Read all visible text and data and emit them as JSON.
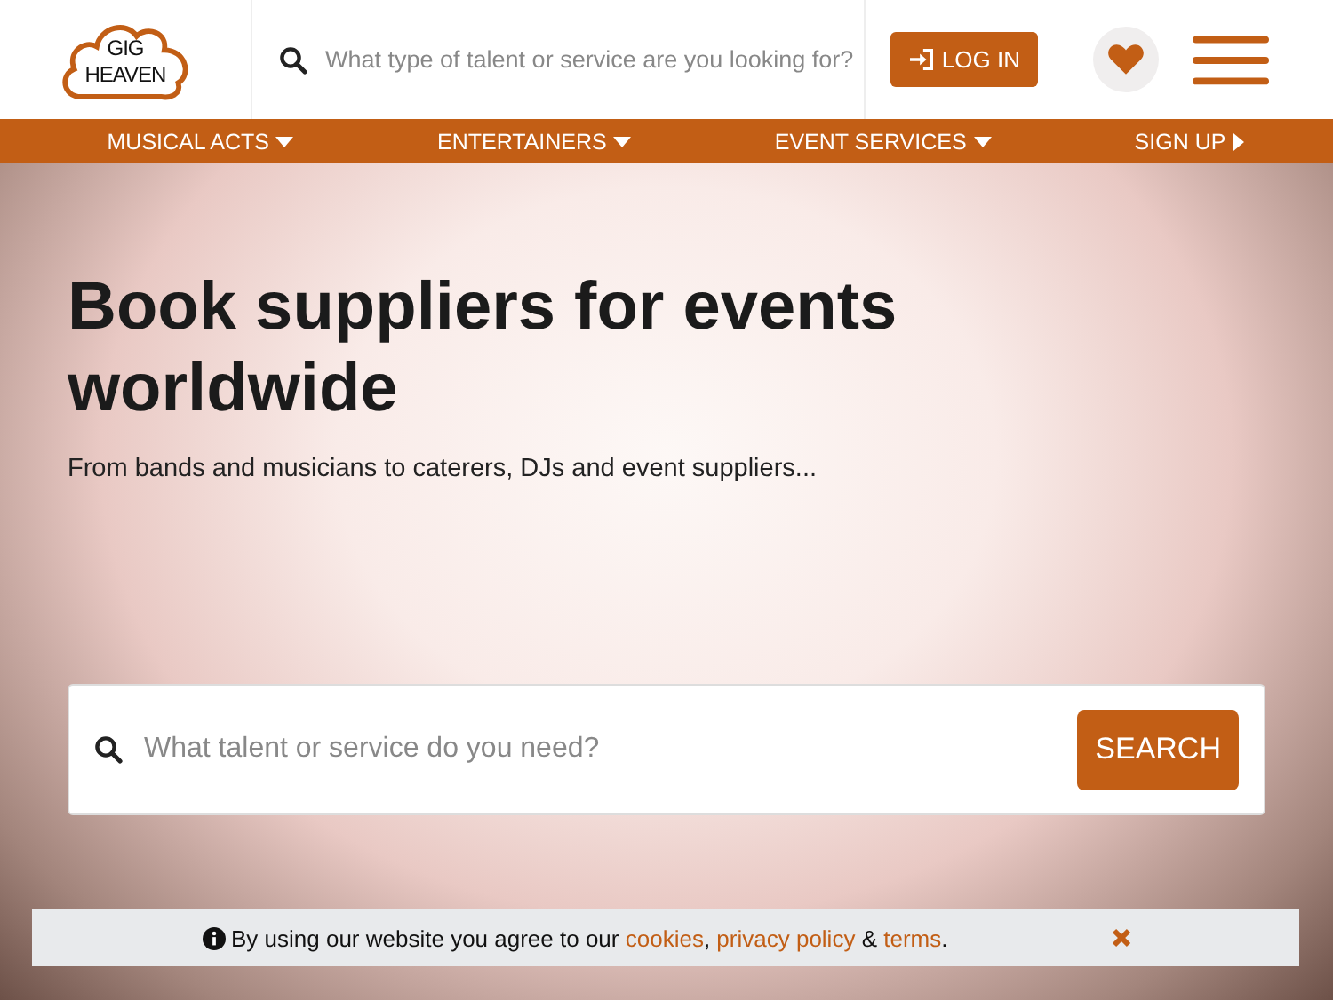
{
  "logo": {
    "line_1": "GIG",
    "line_2": "HEAVEN"
  },
  "header_search": {
    "placeholder": "What type of talent or service are you looking for?"
  },
  "login_button": "LOG IN",
  "nav": [
    {
      "label": "MUSICAL ACTS",
      "kind": "dropdown"
    },
    {
      "label": "ENTERTAINERS",
      "kind": "dropdown"
    },
    {
      "label": "EVENT SERVICES",
      "kind": "dropdown"
    },
    {
      "label": "SIGN UP",
      "kind": "link"
    }
  ],
  "hero": {
    "title": "Book suppliers for events worldwide",
    "subtitle": "From bands and musicians to caterers, DJs and event suppliers...",
    "search": {
      "placeholder": "What talent or service do you need?"
    },
    "search_button": "SEARCH"
  },
  "cookie_bar": {
    "segments": [
      {
        "kind": "text",
        "text": "By using our website you agree to our "
      },
      {
        "kind": "link",
        "text": "cookies"
      },
      {
        "kind": "text",
        "text": ", "
      },
      {
        "kind": "link",
        "text": "privacy policy"
      },
      {
        "kind": "text",
        "text": " & "
      },
      {
        "kind": "link",
        "text": "terms"
      },
      {
        "kind": "text",
        "text": "."
      }
    ]
  }
}
